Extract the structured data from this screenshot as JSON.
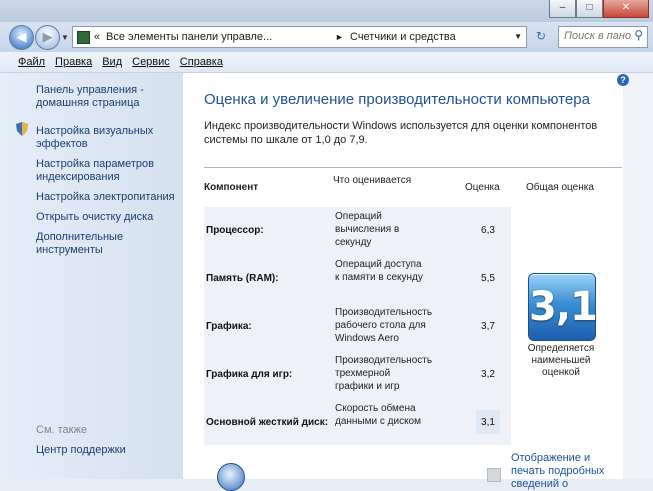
{
  "window": {
    "minimize": "–",
    "maximize": "□",
    "close": "✕"
  },
  "address": {
    "chevron": "«",
    "crumb1": "Все элементы панели управле...",
    "separator": "►",
    "crumb2": "Счетчики и средства производительности",
    "dropdown": "▼",
    "refresh": "↻"
  },
  "search": {
    "placeholder": "Поиск в пано...",
    "icon": "search-icon"
  },
  "menu": [
    "Файл",
    "Правка",
    "Вид",
    "Сервис",
    "Справка"
  ],
  "sidebar": {
    "home": "Панель управления - домашняя страница",
    "links": [
      "Настройка визуальных эффектов",
      "Настройка параметров индексирования",
      "Настройка электропитания",
      "Открыть очистку диска",
      "Дополнительные инструменты"
    ],
    "see_also": "См. также",
    "support": "Центр поддержки"
  },
  "main": {
    "title": "Оценка и увеличение производительности компьютера",
    "description": "Индекс производительности Windows используется для оценки компонентов системы по шкале от 1,0 до 7,9.",
    "headers": {
      "component": "Компонент",
      "what": "Что оценивается",
      "score": "Оценка",
      "overall": "Общая оценка"
    },
    "rows": [
      {
        "component": "Процессор:",
        "what": "Операций вычисления в секунду",
        "score": "6,3"
      },
      {
        "component": "Память (RAM):",
        "what": "Операций доступа к памяти в секунду",
        "score": "5,5"
      },
      {
        "component": "Графика:",
        "what": "Производительность рабочего стола для Windows Aero",
        "score": "3,7"
      },
      {
        "component": "Графика для игр:",
        "what": "Производительность трехмерной графики и игр",
        "score": "3,2"
      },
      {
        "component": "Основной жесткий диск:",
        "what": "Скорость обмена данными с диском",
        "score": "3,1"
      }
    ],
    "overall_score": "3,1",
    "overall_caption": "Определяется наименьшей оценкой",
    "bottom_link": "Отображение и печать подробных сведений о"
  }
}
